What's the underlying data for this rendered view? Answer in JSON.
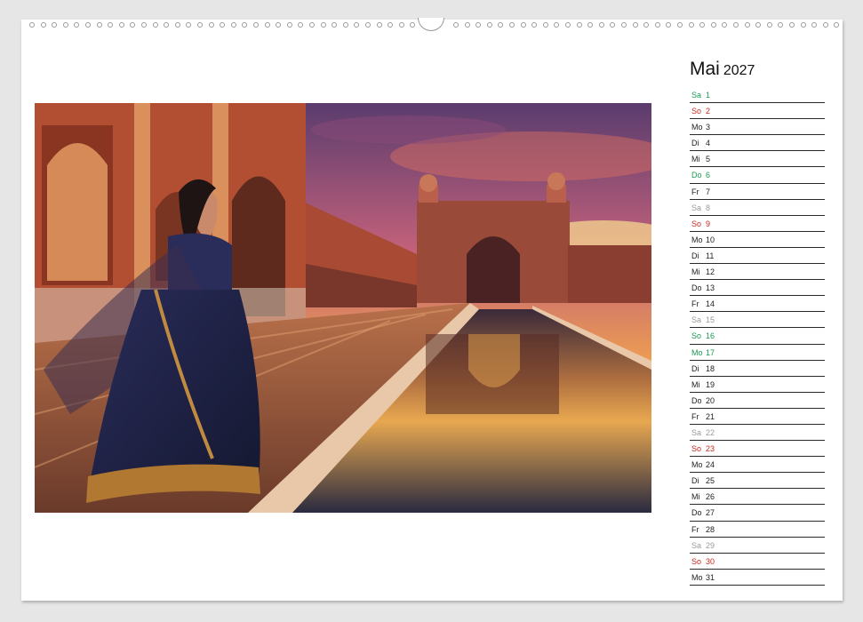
{
  "calendar": {
    "month": "Mai",
    "year": "2027",
    "days": [
      {
        "wd": "Sa",
        "num": "1",
        "type": "hol"
      },
      {
        "wd": "So",
        "num": "2",
        "type": "sun"
      },
      {
        "wd": "Mo",
        "num": "3",
        "type": "week"
      },
      {
        "wd": "Di",
        "num": "4",
        "type": "week"
      },
      {
        "wd": "Mi",
        "num": "5",
        "type": "week"
      },
      {
        "wd": "Do",
        "num": "6",
        "type": "hol"
      },
      {
        "wd": "Fr",
        "num": "7",
        "type": "week"
      },
      {
        "wd": "Sa",
        "num": "8",
        "type": "sat"
      },
      {
        "wd": "So",
        "num": "9",
        "type": "sun"
      },
      {
        "wd": "Mo",
        "num": "10",
        "type": "week"
      },
      {
        "wd": "Di",
        "num": "11",
        "type": "week"
      },
      {
        "wd": "Mi",
        "num": "12",
        "type": "week"
      },
      {
        "wd": "Do",
        "num": "13",
        "type": "week"
      },
      {
        "wd": "Fr",
        "num": "14",
        "type": "week"
      },
      {
        "wd": "Sa",
        "num": "15",
        "type": "sat"
      },
      {
        "wd": "So",
        "num": "16",
        "type": "hol"
      },
      {
        "wd": "Mo",
        "num": "17",
        "type": "hol"
      },
      {
        "wd": "Di",
        "num": "18",
        "type": "week"
      },
      {
        "wd": "Mi",
        "num": "19",
        "type": "week"
      },
      {
        "wd": "Do",
        "num": "20",
        "type": "week"
      },
      {
        "wd": "Fr",
        "num": "21",
        "type": "week"
      },
      {
        "wd": "Sa",
        "num": "22",
        "type": "sat"
      },
      {
        "wd": "So",
        "num": "23",
        "type": "sun"
      },
      {
        "wd": "Mo",
        "num": "24",
        "type": "week"
      },
      {
        "wd": "Di",
        "num": "25",
        "type": "week"
      },
      {
        "wd": "Mi",
        "num": "26",
        "type": "week"
      },
      {
        "wd": "Do",
        "num": "27",
        "type": "week"
      },
      {
        "wd": "Fr",
        "num": "28",
        "type": "week"
      },
      {
        "wd": "Sa",
        "num": "29",
        "type": "sat"
      },
      {
        "wd": "So",
        "num": "30",
        "type": "sun"
      },
      {
        "wd": "Mo",
        "num": "31",
        "type": "week"
      }
    ]
  },
  "colors": {
    "sunday": "#c8281e",
    "holiday": "#1a9a50",
    "saturday": "#9a9a9a",
    "weekday": "#222222"
  }
}
